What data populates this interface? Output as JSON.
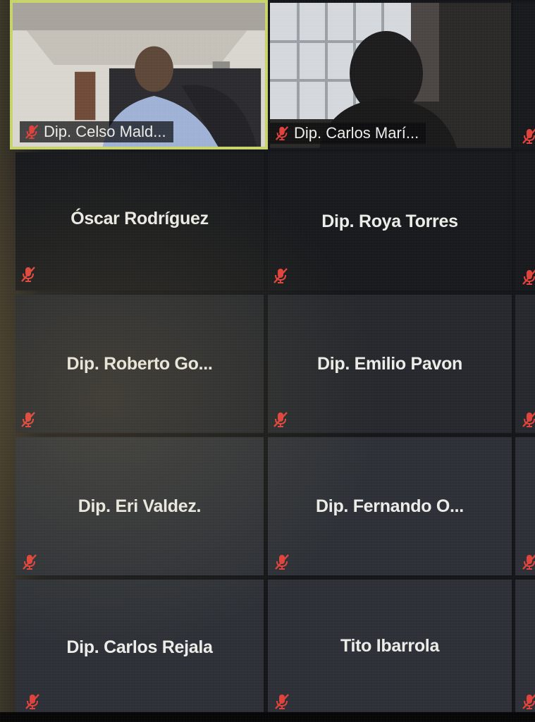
{
  "meeting": {
    "video_participants": [
      {
        "name": "Dip. Celso Mald...",
        "active_speaker": true
      },
      {
        "name": "Dip. Carlos Marí..."
      }
    ],
    "participants": [
      {
        "name": "Óscar Rodríguez"
      },
      {
        "name": "Dip. Roya Torres"
      },
      {
        "name": "Dip.  Roberto  Go..."
      },
      {
        "name": "Dip. Emilio Pavon"
      },
      {
        "name": "Dip. Eri Valdez."
      },
      {
        "name": "Dip.  Fernando  O..."
      },
      {
        "name": "Dip. Carlos Rejala"
      },
      {
        "name": "Tito Ibarrola"
      }
    ]
  },
  "icons": {
    "mute": "microphone-muted-icon"
  },
  "colors": {
    "active_speaker_border": "#c7d36a",
    "mute_icon": "#e0413a",
    "name_text": "#ecece8"
  }
}
